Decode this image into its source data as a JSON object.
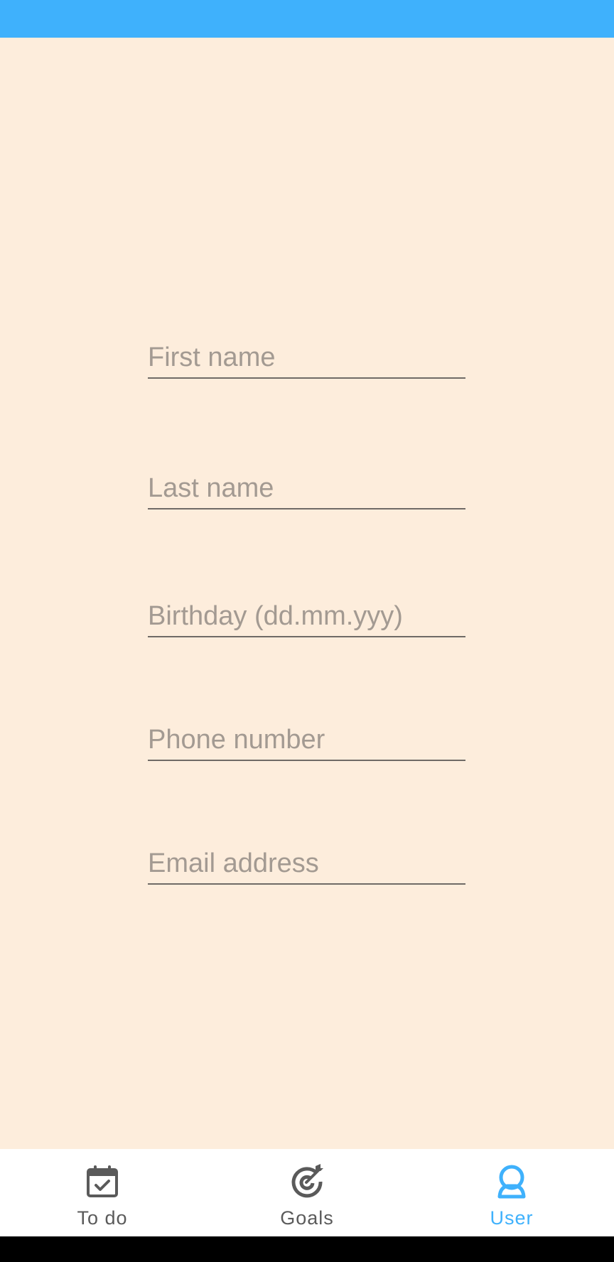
{
  "colors": {
    "status_bar": "#3FB1FC",
    "background": "#FDEDDC",
    "accent": "#3FB1FC",
    "nav_inactive": "#5a5a5a",
    "placeholder": "#a39a92"
  },
  "form": {
    "first_name": {
      "placeholder": "First name",
      "value": ""
    },
    "last_name": {
      "placeholder": "Last name",
      "value": ""
    },
    "birthday": {
      "placeholder": "Birthday (dd.mm.yyy)",
      "value": ""
    },
    "phone": {
      "placeholder": "Phone number",
      "value": ""
    },
    "email": {
      "placeholder": "Email address",
      "value": ""
    }
  },
  "nav": {
    "todo": {
      "label": "To do",
      "icon": "calendar-check-icon"
    },
    "goals": {
      "label": "Goals",
      "icon": "target-icon"
    },
    "user": {
      "label": "User",
      "icon": "user-icon",
      "active": true
    }
  }
}
